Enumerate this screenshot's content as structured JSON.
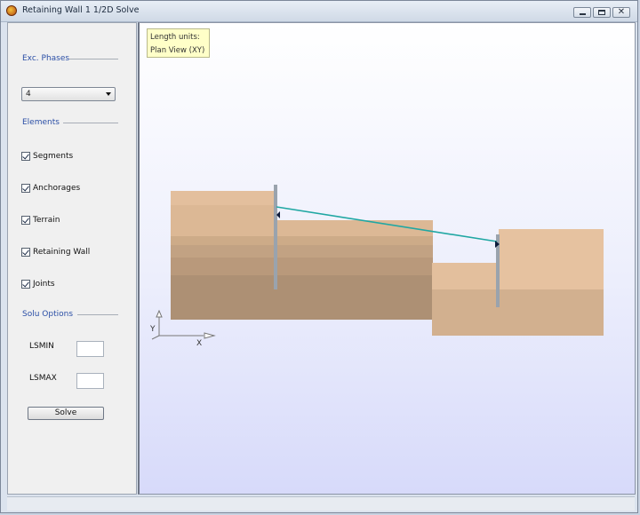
{
  "window": {
    "title": "Retaining Wall 1 1/2D Solve",
    "controls": {
      "minimize": "minimize",
      "maximize": "maximize",
      "close": "✕"
    }
  },
  "sidebar": {
    "exc_phases_label": "Exc. Phases",
    "exc_phase_value": "4",
    "elements_label": "Elements",
    "checkboxes": [
      {
        "label": "Segments",
        "checked": true
      },
      {
        "label": "Anchorages",
        "checked": true
      },
      {
        "label": "Terrain",
        "checked": true
      },
      {
        "label": "Retaining Wall",
        "checked": true
      },
      {
        "label": "Joints",
        "checked": true
      }
    ],
    "solu_options_label": "Solu Options",
    "lsmin_label": "LSMIN",
    "lsmin_value": "",
    "lsmax_label": "LSMAX",
    "lsmax_value": "",
    "solve_label": "Solve"
  },
  "viewport": {
    "legend_line1": "Length units:",
    "legend_line2": "Plan  View (XY)",
    "axis_y": "Y",
    "axis_x": "X"
  },
  "colors": {
    "soil_light": "#e6c1a0",
    "soil_mid": "#d2ae8a",
    "soil_dark": "#ad9073",
    "wall": "#9aa3ad",
    "anchor": "#20a7a3"
  }
}
